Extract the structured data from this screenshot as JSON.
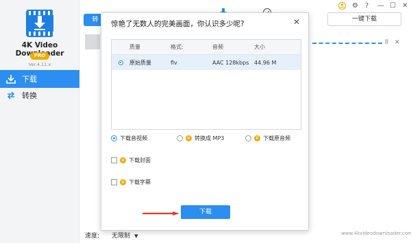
{
  "app": {
    "name": "4K Video Downloader",
    "badge": "PRO",
    "version": "Ver.4.11.x"
  },
  "sidebar": {
    "items": [
      {
        "label": "下载",
        "active": true
      },
      {
        "label": "转换",
        "active": false
      }
    ],
    "speed_label": "速度:",
    "speed_value": "无限制"
  },
  "main": {
    "tab_label": "转",
    "one_click_label": "一键下载",
    "watermark_url": "www.4kvideodownloader.com"
  },
  "modal": {
    "title": "惊艳了无数人的完美画面，你认识多少呢?",
    "columns": [
      "质量",
      "格式:",
      "音频",
      "大小"
    ],
    "rows": [
      {
        "quality": "原始质量",
        "format": "flv",
        "audio": "AAC 128kbps",
        "size": "44.96 M",
        "selected": true
      }
    ],
    "options": {
      "download_video": "下载音视频",
      "convert_mp3": "转换成 MP3",
      "download_audio": "下载原音频",
      "cover": "下载封面",
      "subtitles": "下载字幕"
    },
    "download_button": "下载"
  },
  "colors": {
    "accent": "#2b8ef0",
    "pro": "#f2a900",
    "arrow": "#e03b2e"
  }
}
